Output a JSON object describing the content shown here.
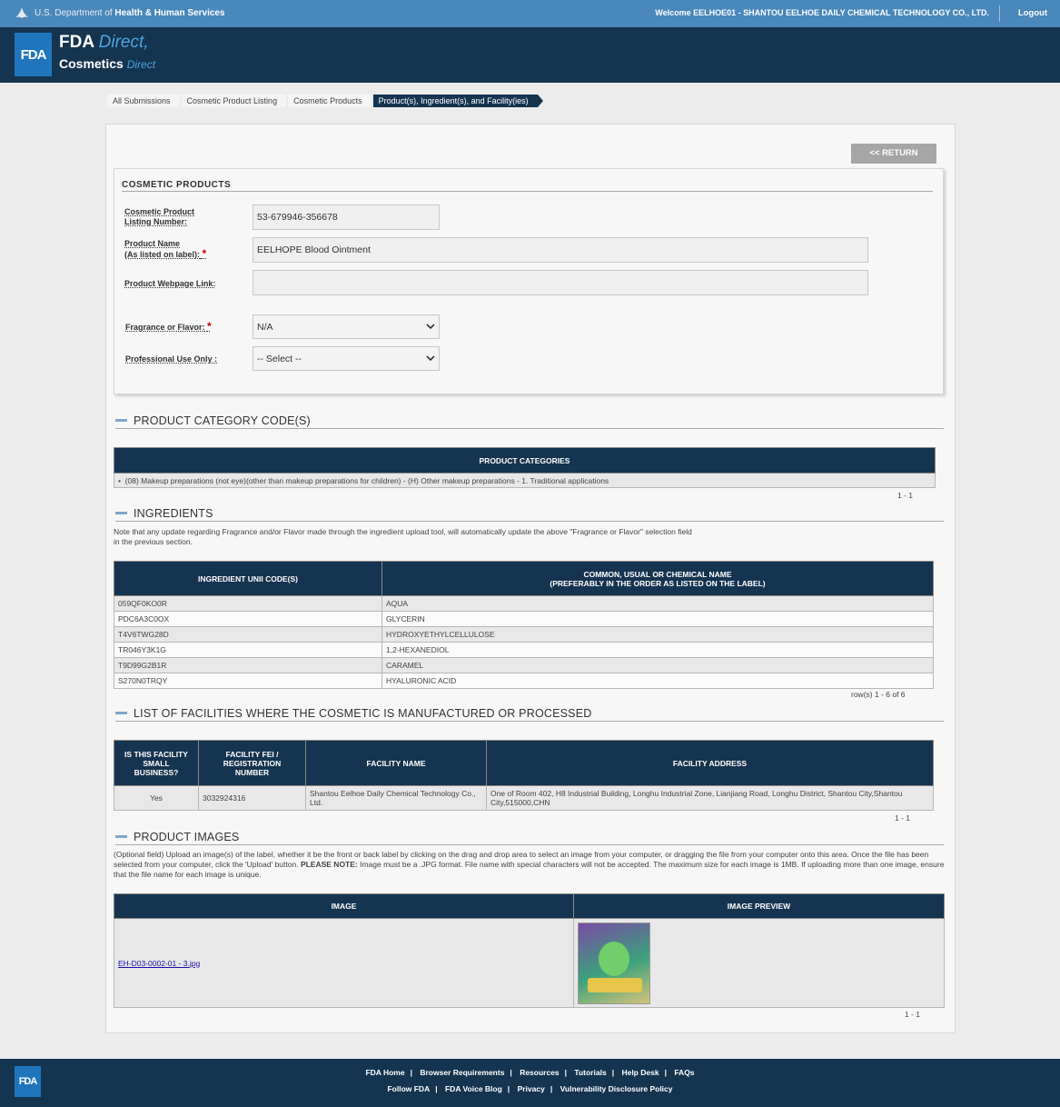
{
  "topbar": {
    "agency_prefix": "U.S. Department of ",
    "agency_name": "Health & Human Services",
    "welcome": "Welcome EELHOE01 - SHANTOU EELHOE DAILY CHEMICAL TECHNOLOGY CO., LTD.",
    "logout": "Logout"
  },
  "header": {
    "logo": "FDA",
    "brand_fda": "FDA ",
    "brand_direct": "Direct",
    "brand_cosmetics": "Cosmetics ",
    "brand_cosmetics_direct": "Direct"
  },
  "breadcrumbs": [
    "All Submissions",
    "Cosmetic Product Listing",
    "Cosmetic Products",
    "Product(s), Ingredient(s), and Facility(ies)"
  ],
  "return_button": "<< RETURN",
  "cosmetic_products": {
    "title": "COSMETIC PRODUCTS",
    "listing_number_label1": "Cosmetic Product",
    "listing_number_label2": "Listing Number:",
    "listing_number": "53-679946-356678",
    "product_name_label1": "Product Name",
    "product_name_label2": "(As listed on label):",
    "product_name": "EELHOPE Blood Ointment",
    "webpage_label": "Product Webpage Link:",
    "webpage": "",
    "fragrance_label": "Fragrance or Flavor:",
    "fragrance": "N/A",
    "professional_label": "Professional Use Only :",
    "professional": "-- Select --"
  },
  "category_section": {
    "title": "PRODUCT CATEGORY CODE(S)",
    "header": "PRODUCT CATEGORIES",
    "row": "(08) Makeup preparations (not eye)(other than makeup preparations for children) - (H) Other makeup preparations - 1. Traditional applications",
    "pager": "1 - 1"
  },
  "ingredients_section": {
    "title": "INGREDIENTS",
    "note1": "Note that any update regarding Fragrance and/or Flavor made through the ingredient upload tool, will automatically update the above \"Fragrance or Flavor\" selection field",
    "note2": "in the previous section.",
    "col1": "INGREDIENT UNII CODE(S)",
    "col2a": "COMMON, USUAL OR CHEMICAL NAME",
    "col2b": "(PREFERABLY IN THE ORDER AS LISTED ON THE LABEL)",
    "rows": [
      [
        "059QF0KO0R",
        "AQUA"
      ],
      [
        "PDC6A3C0OX",
        "GLYCERIN"
      ],
      [
        "T4V6TWG28D",
        "HYDROXYETHYLCELLULOSE"
      ],
      [
        "TR046Y3K1G",
        "1,2-HEXANEDIOL"
      ],
      [
        "T9D99G2B1R",
        "CARAMEL"
      ],
      [
        "S270N0TRQY",
        "HYALURONIC ACID"
      ]
    ],
    "pager": "row(s) 1 - 6 of 6"
  },
  "facilities_section": {
    "title": "LIST OF FACILITIES WHERE THE COSMETIC IS MANUFACTURED OR PROCESSED",
    "col1a": "IS THIS FACILITY",
    "col1b": "SMALL",
    "col1c": "BUSINESS?",
    "col2a": "FACILITY FEI /",
    "col2b": "REGISTRATION",
    "col2c": "NUMBER",
    "col3": "FACILITY NAME",
    "col4": "FACILITY ADDRESS",
    "small": "Yes",
    "fei": "3032924316",
    "name": "Shantou Eelhoe Daily Chemical Technology Co., Ltd.",
    "address": "One of Room 402, H8 Industrial Building, Longhu Industrial Zone, Lianjiang Road, Longhu District, Shantou City,Shantou City,515000,CHN",
    "pager": "1 - 1"
  },
  "images_section": {
    "title": "PRODUCT IMAGES",
    "note_a": "(Optional field) Upload an image(s) of the label, whether it be the front or back label by clicking on the drag and drop area to select an image from your computer, or dragging the file from your computer onto this area. Once the file has been selected from your computer, click the 'Upload' button. ",
    "note_bold": "PLEASE NOTE:",
    "note_b": " Image must be a .JPG format. File name with special characters will not be accepted. The maximum size for each image is 1MB. If uploading more than one image, ensure that the file name for each image is unique.",
    "col1": "IMAGE",
    "col2": "IMAGE PREVIEW",
    "file": "EH-D03-0002-01 - 3.jpg",
    "pager": "1 - 1"
  },
  "footer": {
    "logo": "FDA",
    "row1": [
      "FDA Home",
      "Browser Requirements",
      "Resources",
      "Tutorials",
      "Help Desk",
      "FAQs"
    ],
    "row2": [
      "Follow FDA",
      "FDA Voice Blog",
      "Privacy",
      "Vulnerability Disclosure Policy"
    ]
  }
}
